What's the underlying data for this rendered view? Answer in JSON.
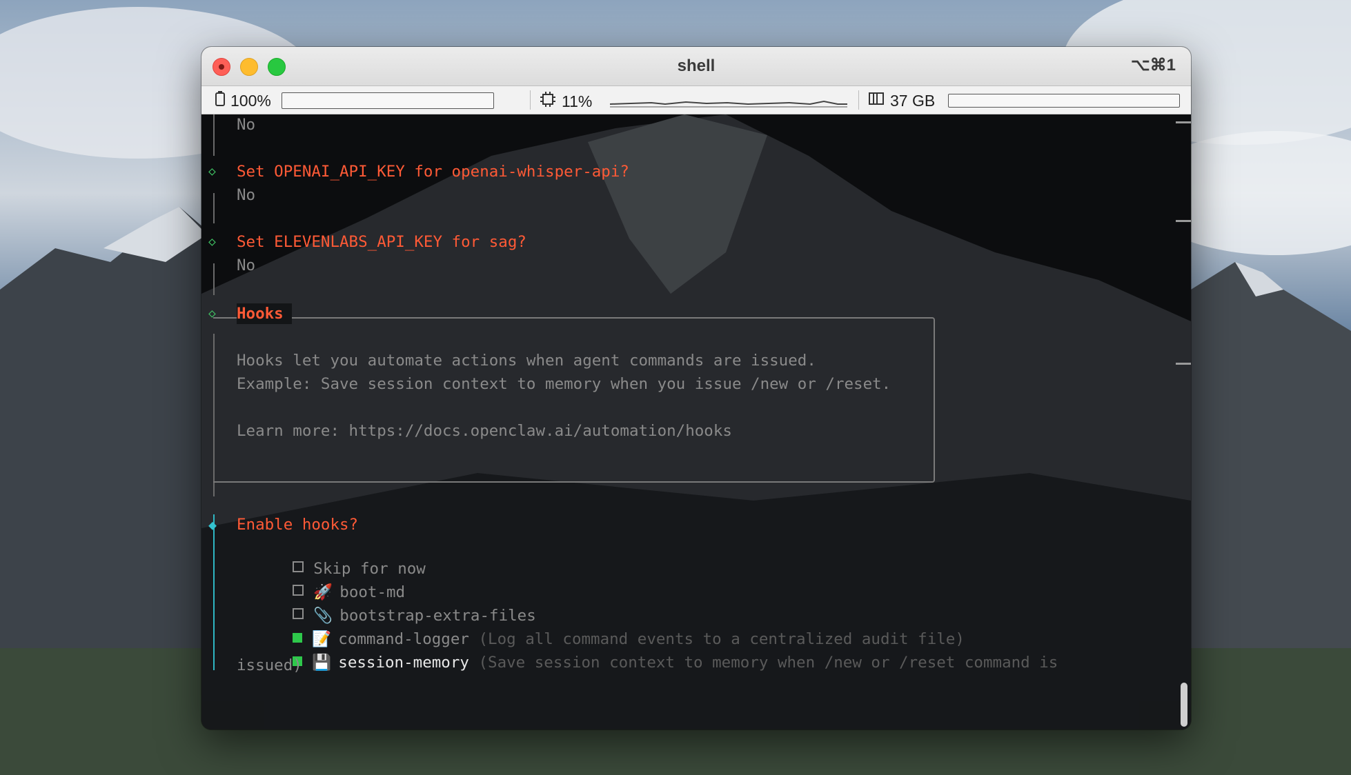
{
  "window": {
    "title": "shell",
    "shortcut": "⌥⌘1"
  },
  "statusbar": {
    "battery": {
      "icon": "battery-icon",
      "label": "100%",
      "level": 1.0
    },
    "cpu": {
      "icon": "cpu-icon",
      "label": "11%"
    },
    "memory": {
      "icon": "memory-icon",
      "label": "37 GB"
    }
  },
  "terminal": {
    "prev_answer": "No",
    "q_openai": "Set OPENAI_API_KEY for openai-whisper-api?",
    "a_openai": "No",
    "q_eleven": "Set ELEVENLABS_API_KEY for sag?",
    "a_eleven": "No",
    "hooks": {
      "title": "Hooks",
      "line1": "Hooks let you automate actions when agent commands are issued.",
      "line2": "Example: Save session context to memory when you issue /new or /reset.",
      "line3": "Learn more: https://docs.openclaw.ai/automation/hooks"
    },
    "prompt": "Enable hooks?",
    "options": [
      {
        "checked": false,
        "emoji": "",
        "label": "Skip for now",
        "desc": ""
      },
      {
        "checked": false,
        "emoji": "🚀",
        "label": "boot-md",
        "desc": ""
      },
      {
        "checked": false,
        "emoji": "📎",
        "label": "bootstrap-extra-files",
        "desc": ""
      },
      {
        "checked": true,
        "emoji": "📝",
        "label": "command-logger",
        "desc": "(Log all command events to a centralized audit file)"
      },
      {
        "checked": true,
        "emoji": "💾",
        "label": "session-memory",
        "desc": "(Save session context to memory when /new or /reset command is"
      }
    ],
    "wrap_tail": "issued)"
  },
  "colors": {
    "accent_orange": "#ff5a36",
    "accent_cyan": "#34c3d0",
    "check_green": "#2ec84b"
  }
}
